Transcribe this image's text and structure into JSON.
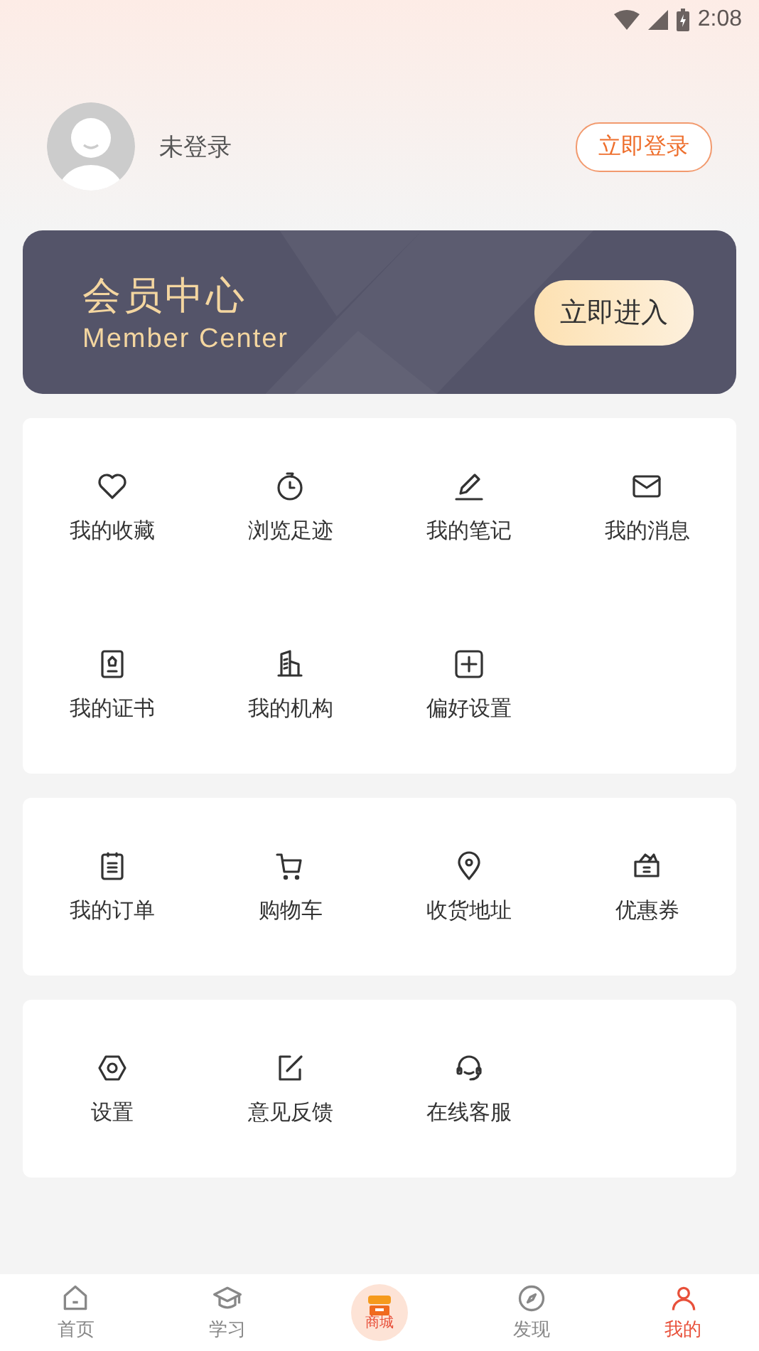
{
  "status_bar": {
    "time": "2:08"
  },
  "profile": {
    "name": "未登录",
    "login_button": "立即登录"
  },
  "member_card": {
    "title": "会员中心",
    "subtitle": "Member Center",
    "button": "立即进入"
  },
  "sections": [
    {
      "items": [
        {
          "label": "我的收藏",
          "kind": "heart"
        },
        {
          "label": "浏览足迹",
          "kind": "clock"
        },
        {
          "label": "我的笔记",
          "kind": "pencil"
        },
        {
          "label": "我的消息",
          "kind": "mail"
        },
        {
          "label": "我的证书",
          "kind": "certificate"
        },
        {
          "label": "我的机构",
          "kind": "building"
        },
        {
          "label": "偏好设置",
          "kind": "plus"
        }
      ]
    },
    {
      "items": [
        {
          "label": "我的订单",
          "kind": "list"
        },
        {
          "label": "购物车",
          "kind": "cart"
        },
        {
          "label": "收货地址",
          "kind": "pin"
        },
        {
          "label": "优惠券",
          "kind": "wallet"
        }
      ]
    },
    {
      "items": [
        {
          "label": "设置",
          "kind": "hexagon"
        },
        {
          "label": "意见反馈",
          "kind": "edit"
        },
        {
          "label": "在线客服",
          "kind": "headset"
        }
      ]
    }
  ],
  "bottom_nav": [
    {
      "label": "首页",
      "kind": "home",
      "selected": false
    },
    {
      "label": "学习",
      "kind": "cap",
      "selected": false
    },
    {
      "label": "商城",
      "kind": "shop",
      "selected": false
    },
    {
      "label": "发现",
      "kind": "compass",
      "selected": false
    },
    {
      "label": "我的",
      "kind": "user",
      "selected": true
    }
  ]
}
